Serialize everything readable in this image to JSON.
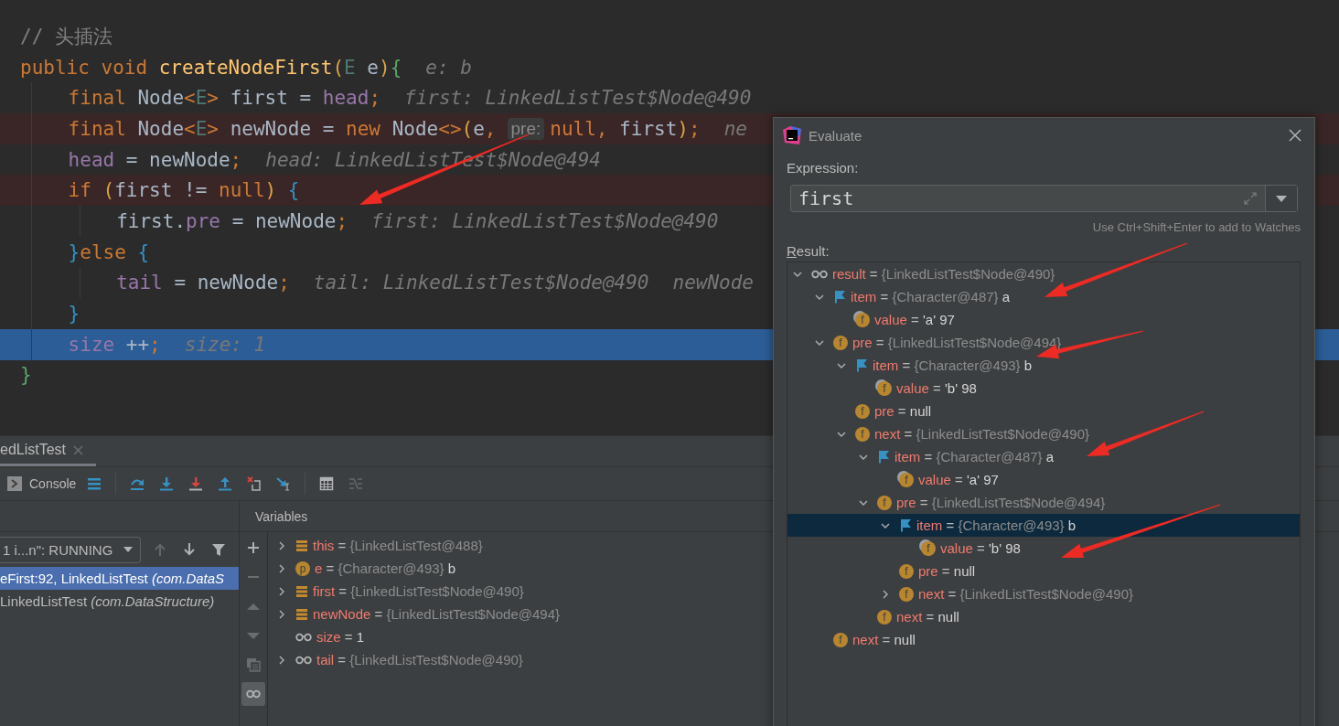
{
  "editor": {
    "lines": [
      {
        "kind": "plain",
        "segments": [
          {
            "kind": "code",
            "tokens": [
              {
                "kind": "comment",
                "text": "// 头插法"
              }
            ]
          }
        ]
      },
      {
        "kind": "plain",
        "segments": [
          {
            "kind": "code",
            "tokens": [
              {
                "kind": "keyword",
                "text": "public void "
              },
              {
                "kind": "method",
                "text": "createNodeFirst"
              },
              {
                "kind": "paren",
                "text": "("
              },
              {
                "kind": "type_param",
                "text": "E"
              },
              {
                "kind": "plain",
                "text": " e"
              },
              {
                "kind": "paren",
                "text": ")"
              },
              {
                "kind": "brace_outer",
                "text": "{"
              }
            ]
          },
          {
            "kind": "hint",
            "text": "e: b"
          }
        ],
        "children": [
          {
            "kind": "plain",
            "segments": [
              {
                "kind": "code",
                "tokens": [
                  {
                    "kind": "keyword",
                    "text": "final "
                  },
                  {
                    "kind": "plain",
                    "text": "Node"
                  },
                  {
                    "kind": "keyword",
                    "text": "<"
                  },
                  {
                    "kind": "type_param",
                    "text": "E"
                  },
                  {
                    "kind": "keyword",
                    "text": ">"
                  },
                  {
                    "kind": "plain",
                    "text": " first = "
                  },
                  {
                    "kind": "field",
                    "text": "head"
                  },
                  {
                    "kind": "keyword",
                    "text": ";"
                  }
                ]
              },
              {
                "kind": "hint",
                "text": "first: LinkedListTest$Node@490"
              }
            ]
          },
          {
            "kind": "breakpoint",
            "segments": [
              {
                "kind": "code",
                "tokens": [
                  {
                    "kind": "keyword",
                    "text": "final "
                  },
                  {
                    "kind": "plain",
                    "text": "Node"
                  },
                  {
                    "kind": "keyword",
                    "text": "<"
                  },
                  {
                    "kind": "type_param",
                    "text": "E"
                  },
                  {
                    "kind": "keyword",
                    "text": ">"
                  },
                  {
                    "kind": "plain",
                    "text": " newNode = "
                  },
                  {
                    "kind": "keyword",
                    "text": "new "
                  },
                  {
                    "kind": "plain",
                    "text": "Node"
                  },
                  {
                    "kind": "keyword",
                    "text": "<>"
                  },
                  {
                    "kind": "paren",
                    "text": "("
                  },
                  {
                    "kind": "plain",
                    "text": "e"
                  },
                  {
                    "kind": "keyword",
                    "text": ","
                  }
                ]
              },
              {
                "kind": "param",
                "text": "pre:"
              },
              {
                "kind": "code",
                "tokens": [
                  {
                    "kind": "keyword",
                    "text": "null, "
                  },
                  {
                    "kind": "plain",
                    "text": "first"
                  },
                  {
                    "kind": "paren",
                    "text": ")"
                  },
                  {
                    "kind": "keyword",
                    "text": ";"
                  }
                ]
              },
              {
                "kind": "hint",
                "text": "ne"
              }
            ]
          },
          {
            "kind": "plain",
            "segments": [
              {
                "kind": "code",
                "tokens": [
                  {
                    "kind": "field",
                    "text": "head"
                  },
                  {
                    "kind": "plain",
                    "text": " = newNode"
                  },
                  {
                    "kind": "keyword",
                    "text": ";"
                  }
                ]
              },
              {
                "kind": "hint",
                "text": "head: LinkedListTest$Node@494"
              }
            ]
          },
          {
            "kind": "breakpoint",
            "segments": [
              {
                "kind": "code",
                "tokens": [
                  {
                    "kind": "keyword",
                    "text": "if "
                  },
                  {
                    "kind": "paren",
                    "text": "("
                  },
                  {
                    "kind": "plain",
                    "text": "first != "
                  },
                  {
                    "kind": "keyword",
                    "text": "null"
                  },
                  {
                    "kind": "paren",
                    "text": ") "
                  },
                  {
                    "kind": "brace_inner",
                    "text": "{"
                  }
                ]
              }
            ],
            "children": [
              {
                "kind": "plain",
                "segments": [
                  {
                    "kind": "code",
                    "tokens": [
                      {
                        "kind": "plain",
                        "text": "first."
                      },
                      {
                        "kind": "field",
                        "text": "pre"
                      },
                      {
                        "kind": "plain",
                        "text": " = newNode"
                      },
                      {
                        "kind": "keyword",
                        "text": ";"
                      }
                    ]
                  },
                  {
                    "kind": "hint",
                    "text": "first: LinkedListTest$Node@490"
                  }
                ]
              }
            ]
          },
          {
            "kind": "plain",
            "segments": [
              {
                "kind": "code",
                "tokens": [
                  {
                    "kind": "brace_inner",
                    "text": "}"
                  },
                  {
                    "kind": "keyword",
                    "text": "else "
                  },
                  {
                    "kind": "brace_inner",
                    "text": "{"
                  }
                ]
              }
            ],
            "children": [
              {
                "kind": "plain",
                "segments": [
                  {
                    "kind": "code",
                    "tokens": [
                      {
                        "kind": "field",
                        "text": "tail"
                      },
                      {
                        "kind": "plain",
                        "text": " = newNode"
                      },
                      {
                        "kind": "keyword",
                        "text": ";"
                      }
                    ]
                  },
                  {
                    "kind": "hint",
                    "text": "tail: LinkedListTest$Node@490"
                  },
                  {
                    "kind": "hint",
                    "text": "newNode"
                  }
                ]
              }
            ]
          },
          {
            "kind": "plain",
            "segments": [
              {
                "kind": "code",
                "tokens": [
                  {
                    "kind": "brace_inner",
                    "text": "}"
                  }
                ]
              }
            ]
          },
          {
            "kind": "current",
            "segments": [
              {
                "kind": "code",
                "tokens": [
                  {
                    "kind": "field",
                    "text": "size"
                  },
                  {
                    "kind": "plain",
                    "text": " ++"
                  },
                  {
                    "kind": "keyword",
                    "text": ";"
                  }
                ]
              },
              {
                "kind": "hint",
                "text": "size: 1"
              }
            ]
          }
        ]
      },
      {
        "kind": "plain",
        "segments": [
          {
            "kind": "code",
            "tokens": [
              {
                "kind": "brace_outer",
                "text": "}"
              }
            ]
          }
        ]
      }
    ]
  },
  "debug": {
    "tab": {
      "label": "edListTest"
    },
    "toolbar": [
      {
        "kind": "console",
        "label": "Console"
      },
      {
        "kind": "menu",
        "disabled": false
      },
      {
        "kind": "separator"
      },
      {
        "kind": "step_over",
        "disabled": false
      },
      {
        "kind": "step_into",
        "disabled": false
      },
      {
        "kind": "force_step_into",
        "disabled": false
      },
      {
        "kind": "step_out",
        "disabled": false
      },
      {
        "kind": "drop_frame",
        "disabled": false
      },
      {
        "kind": "run_to_cursor",
        "disabled": false
      },
      {
        "kind": "separator"
      },
      {
        "kind": "evaluate",
        "disabled": false
      },
      {
        "kind": "trace",
        "disabled": true
      }
    ],
    "thread": {
      "value": "1 i...n\": RUNNING"
    },
    "frame_nav": [
      {
        "kind": "up",
        "disabled": true
      },
      {
        "kind": "down",
        "disabled": false
      },
      {
        "kind": "filter",
        "disabled": false
      }
    ],
    "frames": [
      {
        "text": "eFirst:92, LinkedListTest *(com.DataS*",
        "selected": true
      },
      {
        "text": "LinkedListTest *(com.DataStructure)*",
        "selected": false
      }
    ],
    "variables_title": "Variables",
    "side_toolbar": [
      {
        "kind": "add",
        "disabled": false,
        "selected": false
      },
      {
        "kind": "remove",
        "disabled": true,
        "selected": false
      },
      {
        "kind": "up",
        "disabled": true,
        "selected": false
      },
      {
        "kind": "down",
        "disabled": true,
        "selected": false
      },
      {
        "kind": "copy",
        "disabled": true,
        "selected": false
      },
      {
        "kind": "watches",
        "disabled": false,
        "selected": true
      }
    ],
    "variables": [
      {
        "name": "this",
        "kind": "stack",
        "expanded": false,
        "equals": "=",
        "ref": "{LinkedListTest@488}"
      },
      {
        "name": "e",
        "kind": "param",
        "badge": "p",
        "expanded": false,
        "equals": "=",
        "ref": "{Character@493}",
        "value": "b"
      },
      {
        "name": "first",
        "kind": "stack",
        "expanded": false,
        "equals": "=",
        "ref": "{LinkedListTest$Node@490}"
      },
      {
        "name": "newNode",
        "kind": "stack",
        "expanded": false,
        "equals": "=",
        "ref": "{LinkedListTest$Node@494}"
      },
      {
        "name": "size",
        "kind": "watch",
        "equals": "=",
        "value": "1"
      },
      {
        "name": "tail",
        "kind": "watch",
        "expanded": false,
        "equals": "=",
        "ref": "{LinkedListTest$Node@490}"
      }
    ]
  },
  "evaluate": {
    "title": "Evaluate",
    "expression_label": "Expression:",
    "expression": "first",
    "hint": "Use Ctrl+Shift+Enter to add to Watches",
    "result_label": "Result:",
    "tree": [
      {
        "name": "result",
        "kind": "watch",
        "expanded": true,
        "selected": false,
        "equals": "=",
        "ref": "{LinkedListTest$Node@490}",
        "children": [
          {
            "name": "item",
            "kind": "flag",
            "expanded": true,
            "selected": false,
            "equals": "=",
            "ref": "{Character@487}",
            "value": "a",
            "children": [
              {
                "name": "value",
                "kind": "final_field",
                "badge": "f",
                "selected": false,
                "equals": "=",
                "value": "'a' 97"
              }
            ]
          },
          {
            "name": "pre",
            "kind": "field",
            "badge": "f",
            "expanded": true,
            "selected": false,
            "equals": "=",
            "ref": "{LinkedListTest$Node@494}",
            "children": [
              {
                "name": "item",
                "kind": "flag",
                "expanded": true,
                "selected": false,
                "equals": "=",
                "ref": "{Character@493}",
                "value": "b",
                "children": [
                  {
                    "name": "value",
                    "kind": "final_field",
                    "badge": "f",
                    "selected": false,
                    "equals": "=",
                    "value": "'b' 98"
                  }
                ]
              },
              {
                "name": "pre",
                "kind": "field",
                "badge": "f",
                "selected": false,
                "equals": "=",
                "value": "null"
              },
              {
                "name": "next",
                "kind": "field",
                "badge": "f",
                "expanded": true,
                "selected": false,
                "equals": "=",
                "ref": "{LinkedListTest$Node@490}",
                "children": [
                  {
                    "name": "item",
                    "kind": "flag",
                    "expanded": true,
                    "selected": false,
                    "equals": "=",
                    "ref": "{Character@487}",
                    "value": "a",
                    "children": [
                      {
                        "name": "value",
                        "kind": "final_field",
                        "badge": "f",
                        "selected": false,
                        "equals": "=",
                        "value": "'a' 97"
                      }
                    ]
                  },
                  {
                    "name": "pre",
                    "kind": "field",
                    "badge": "f",
                    "expanded": true,
                    "selected": false,
                    "equals": "=",
                    "ref": "{LinkedListTest$Node@494}",
                    "children": [
                      {
                        "name": "item",
                        "kind": "flag",
                        "expanded": true,
                        "selected": true,
                        "equals": "=",
                        "ref": "{Character@493}",
                        "value": "b",
                        "children": [
                          {
                            "name": "value",
                            "kind": "final_field",
                            "badge": "f",
                            "selected": false,
                            "equals": "=",
                            "value": "'b' 98"
                          }
                        ]
                      },
                      {
                        "name": "pre",
                        "kind": "field",
                        "badge": "f",
                        "selected": false,
                        "equals": "=",
                        "value": "null"
                      },
                      {
                        "name": "next",
                        "kind": "field",
                        "badge": "f",
                        "expanded": false,
                        "selected": false,
                        "equals": "=",
                        "ref": "{LinkedListTest$Node@490}"
                      }
                    ]
                  },
                  {
                    "name": "next",
                    "kind": "field",
                    "badge": "f",
                    "selected": false,
                    "equals": "=",
                    "value": "null"
                  }
                ]
              }
            ]
          },
          {
            "name": "next",
            "kind": "field",
            "badge": "f",
            "selected": false,
            "equals": "=",
            "value": "null"
          }
        ]
      }
    ]
  }
}
